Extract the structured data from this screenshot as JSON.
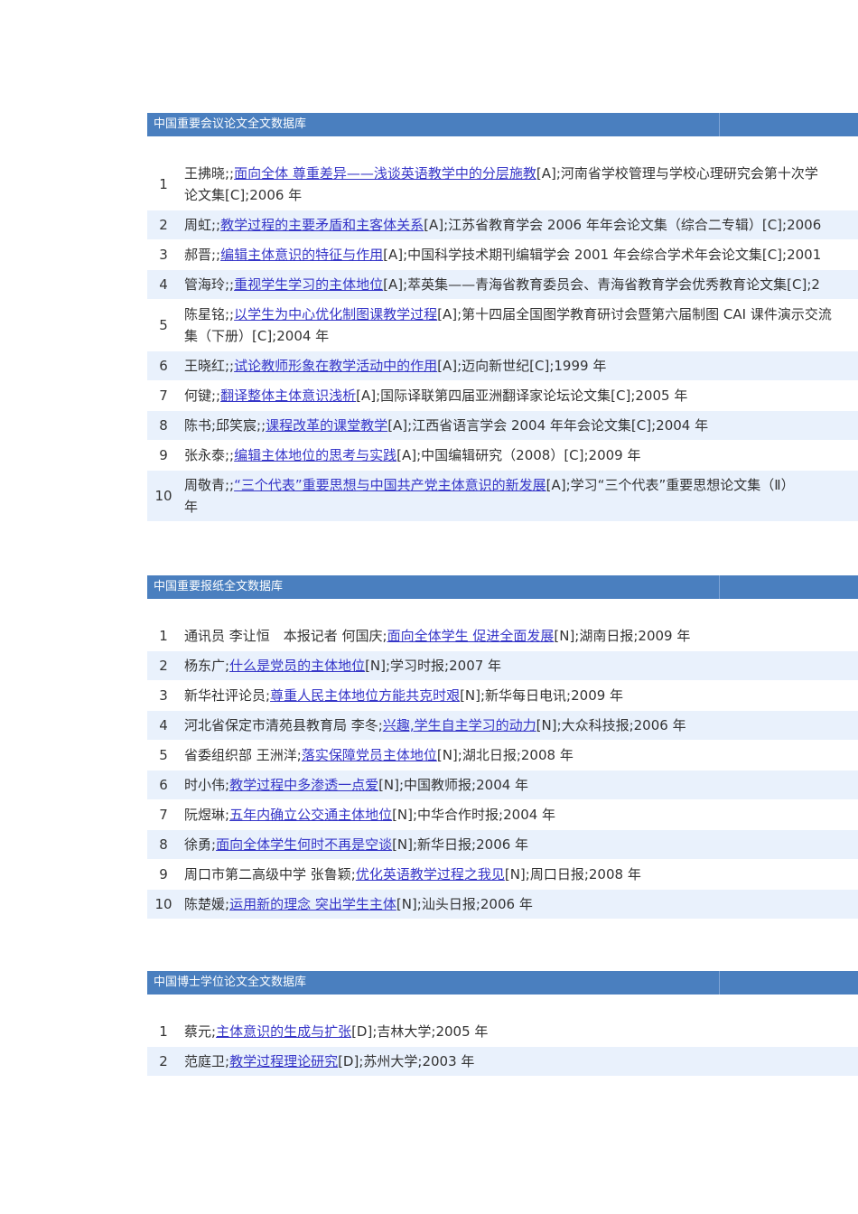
{
  "sections": [
    {
      "title": "中国重要会议论文全文数据库",
      "rows": [
        {
          "n": "1",
          "pre": "王拂晓;;",
          "link": "面向全体 尊重差异——浅谈英语教学中的分层施教",
          "post": "[A];河南省学校管理与学校心理研究会第十次学",
          "line2": "论文集[C];2006 年"
        },
        {
          "n": "2",
          "pre": "周虹;;",
          "link": "教学过程的主要矛盾和主客体关系",
          "post": "[A];江苏省教育学会 2006 年年会论文集（综合二专辑）[C];2006"
        },
        {
          "n": "3",
          "pre": "郝晋;;",
          "link": "编辑主体意识的特征与作用",
          "post": "[A];中国科学技术期刊编辑学会 2001 年会综合学术年会论文集[C];2001"
        },
        {
          "n": "4",
          "pre": "管海玲;;",
          "link": "重视学生学习的主体地位",
          "post": "[A];萃英集——青海省教育委员会、青海省教育学会优秀教育论文集[C];2"
        },
        {
          "n": "5",
          "pre": "陈星铭;;",
          "link": "以学生为中心优化制图课教学过程",
          "post": "[A];第十四届全国图学教育研讨会暨第六届制图 CAI 课件演示交流",
          "line2": "集（下册）[C];2004 年"
        },
        {
          "n": "6",
          "pre": "王晓红;;",
          "link": "试论教师形象在教学活动中的作用",
          "post": "[A];迈向新世纪[C];1999 年"
        },
        {
          "n": "7",
          "pre": "何键;;",
          "link": "翻译整体主体意识浅析",
          "post": "[A];国际译联第四届亚洲翻译家论坛论文集[C];2005 年"
        },
        {
          "n": "8",
          "pre": "陈书;邱笑宸;;",
          "link": "课程改革的课堂教学",
          "post": "[A];江西省语言学会 2004 年年会论文集[C];2004 年"
        },
        {
          "n": "9",
          "pre": "张永泰;;",
          "link": "编辑主体地位的思考与实践",
          "post": "[A];中国编辑研究（2008）[C];2009 年"
        },
        {
          "n": "10",
          "pre": "周敬青;;",
          "link": "“三个代表”重要思想与中国共产党主体意识的新发展",
          "post": "[A];学习“三个代表”重要思想论文集（Ⅱ）",
          "line2": "年"
        }
      ]
    },
    {
      "title": "中国重要报纸全文数据库",
      "rows": [
        {
          "n": "1",
          "pre": "通讯员 李让恒　本报记者 何国庆;",
          "link": "面向全体学生 促进全面发展",
          "post": "[N];湖南日报;2009 年"
        },
        {
          "n": "2",
          "pre": "杨东广;",
          "link": "什么是党员的主体地位",
          "post": "[N];学习时报;2007 年"
        },
        {
          "n": "3",
          "pre": "新华社评论员;",
          "link": "尊重人民主体地位方能共克时艰",
          "post": "[N];新华每日电讯;2009 年"
        },
        {
          "n": "4",
          "pre": "河北省保定市清苑县教育局 李冬;",
          "link": "兴趣,学生自主学习的动力",
          "post": "[N];大众科技报;2006 年"
        },
        {
          "n": "5",
          "pre": "省委组织部 王洲洋;",
          "link": "落实保障党员主体地位",
          "post": "[N];湖北日报;2008 年"
        },
        {
          "n": "6",
          "pre": "时小伟;",
          "link": "教学过程中多渗透一点爱",
          "post": "[N];中国教师报;2004 年"
        },
        {
          "n": "7",
          "pre": "阮煜琳;",
          "link": "五年内确立公交通主体地位",
          "post": "[N];中华合作时报;2004 年"
        },
        {
          "n": "8",
          "pre": "徐勇;",
          "link": "面向全体学生何时不再是空谈",
          "post": "[N];新华日报;2006 年"
        },
        {
          "n": "9",
          "pre": "周口市第二高级中学 张鲁颖;",
          "link": "优化英语教学过程之我见",
          "post": "[N];周口日报;2008 年"
        },
        {
          "n": "10",
          "pre": "陈楚媛;",
          "link": "运用新的理念 突出学生主体",
          "post": "[N];汕头日报;2006 年"
        }
      ]
    },
    {
      "title": "中国博士学位论文全文数据库",
      "rows": [
        {
          "n": "1",
          "pre": "蔡元;",
          "link": "主体意识的生成与扩张",
          "post": "[D];吉林大学;2005 年"
        },
        {
          "n": "2",
          "pre": "范庭卫;",
          "link": "教学过程理论研究",
          "post": "[D];苏州大学;2003 年"
        }
      ]
    }
  ]
}
